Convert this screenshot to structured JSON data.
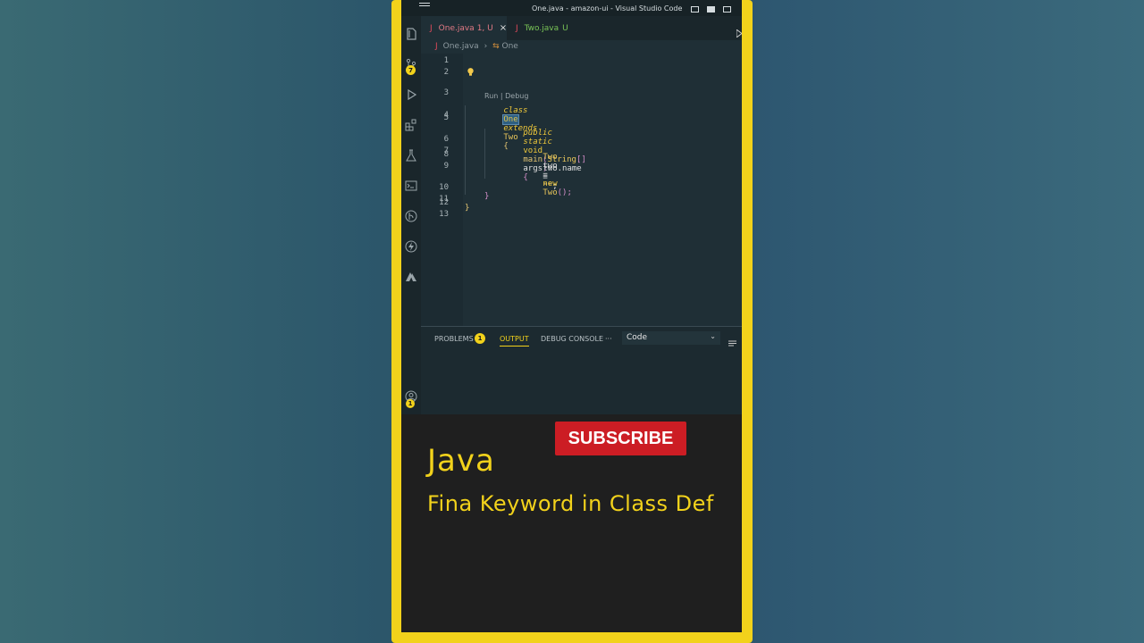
{
  "window": {
    "title": "One.java - amazon-ui - Visual Studio Code"
  },
  "activity_bar": {
    "source_control_badge": "7",
    "accounts_badge": "1"
  },
  "tabs": [
    {
      "icon": "J",
      "label": "One.java",
      "status": "1, U",
      "close": "×"
    },
    {
      "icon": "J",
      "label": "Two.java",
      "status": "U"
    }
  ],
  "breadcrumb": {
    "file": "One.java",
    "separator": "›",
    "symbol": "One"
  },
  "editor": {
    "line_numbers": [
      "1",
      "2",
      "3",
      "4",
      "5",
      "6",
      "7",
      "8",
      "9",
      "10",
      "11",
      "12",
      "13"
    ],
    "codelens": "Run | Debug",
    "line3": {
      "kw_class": "class",
      "name": "One",
      "kw_extends": "extends",
      "parent": "Two",
      "brace": "{"
    },
    "line4": {
      "kw_public": "public",
      "kw_static": "static",
      "kw_void": "void",
      "method": "main",
      "paren_open": "(",
      "type": "String",
      "brackets": "[]",
      "arg": "args",
      "paren_close": ")",
      "brace": "{"
    },
    "line6": {
      "type": "Two",
      "var": "two",
      "eq": "=",
      "kw_new": "new",
      "ctor": "Two",
      "call": "();"
    },
    "line7": {
      "obj": "two",
      "dot": ".",
      "field": "name",
      "eq": "=",
      "value": "\"\"",
      "semi": ";"
    },
    "line10": "}",
    "line11": "}"
  },
  "panel": {
    "tabs": [
      "PROBLEMS",
      "OUTPUT",
      "DEBUG CONSOLE"
    ],
    "problems_count": "1",
    "more": "···",
    "select_value": "Code",
    "active_tab": "OUTPUT"
  },
  "promo": {
    "subscribe": "SUBSCRIBE",
    "title": "Java",
    "subtitle": "Fina Keyword in Class Def"
  },
  "colors": {
    "frame": "#f2d21b",
    "subscribe_bg": "#cc1d24",
    "editor_bg": "#1f2f36",
    "accent": "#f2d21b"
  }
}
